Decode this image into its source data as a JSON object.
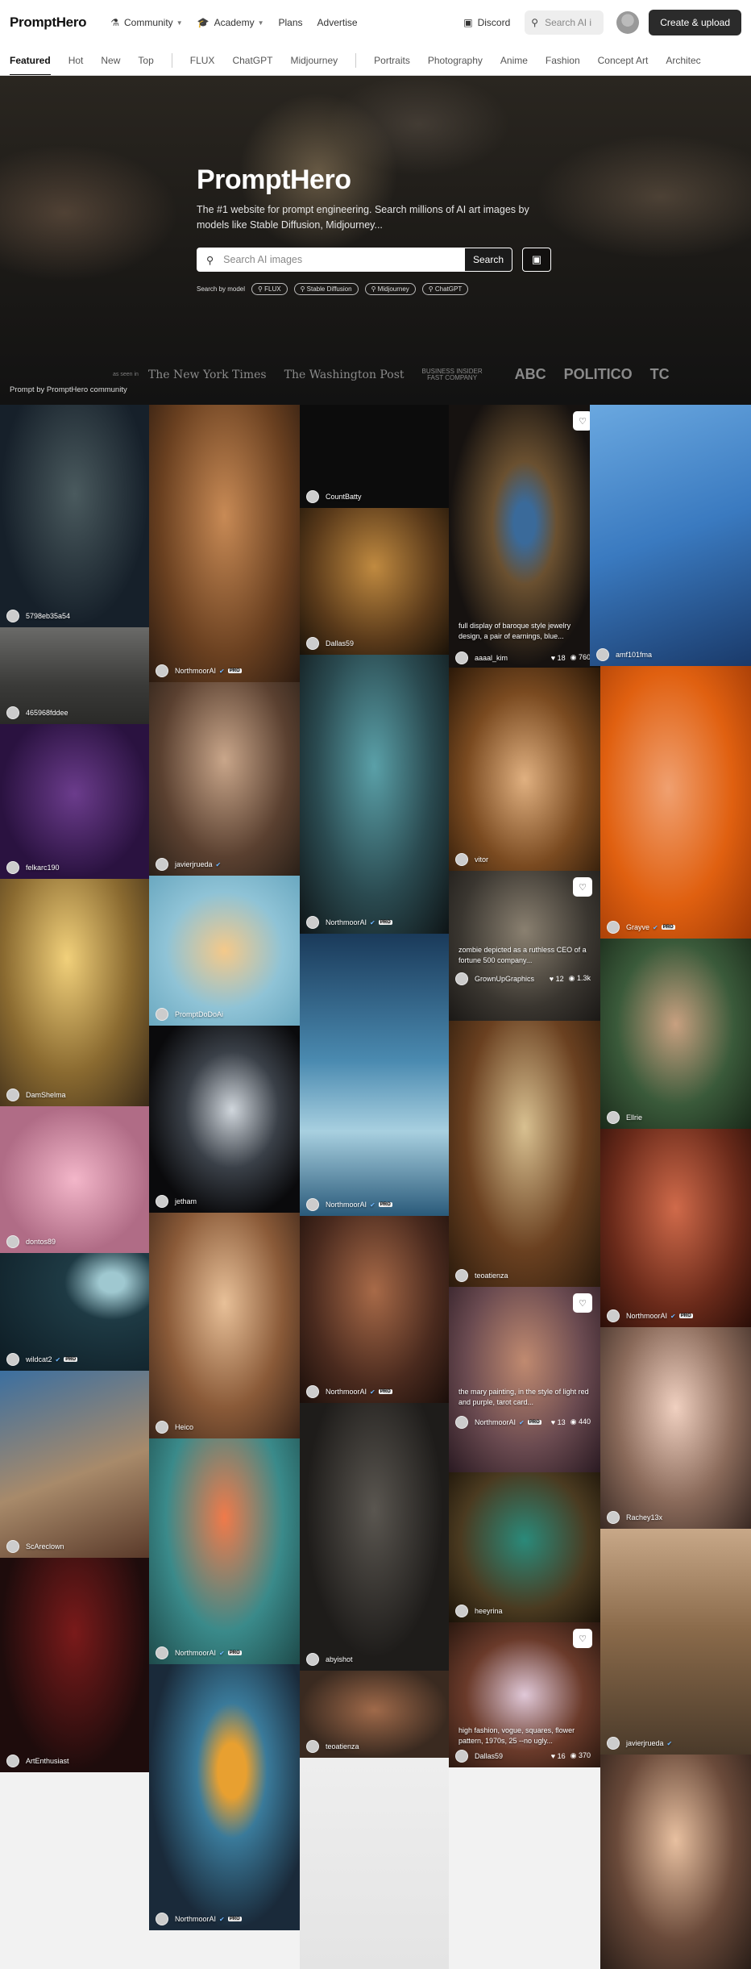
{
  "header": {
    "logo": "PromptHero",
    "nav": [
      {
        "icon": "community-icon",
        "label": "Community",
        "dropdown": true
      },
      {
        "icon": "academy-icon",
        "label": "Academy",
        "dropdown": true
      },
      {
        "icon": "",
        "label": "Plans",
        "dropdown": false
      },
      {
        "icon": "",
        "label": "Advertise",
        "dropdown": false
      }
    ],
    "discord_label": "Discord",
    "search_placeholder": "Search AI i",
    "create_button": "Create & upload"
  },
  "tabs": {
    "group1": [
      "Featured",
      "Hot",
      "New",
      "Top"
    ],
    "group2": [
      "FLUX",
      "ChatGPT",
      "Midjourney"
    ],
    "group3": [
      "Portraits",
      "Photography",
      "Anime",
      "Fashion",
      "Concept Art",
      "Architec"
    ],
    "active": "Featured"
  },
  "hero": {
    "title": "PromptHero",
    "subtitle": "The #1 website for prompt engineering. Search millions of AI art images by models like Stable Diffusion, Midjourney...",
    "search_placeholder": "Search AI images",
    "search_button": "Search",
    "models_label": "Search by model",
    "models": [
      "FLUX",
      "Stable Diffusion",
      "Midjourney",
      "ChatGPT"
    ],
    "press_label": "as seen in",
    "press": [
      "The New York Times",
      "The Washington Post",
      "BUSINESS INSIDER",
      "FAST COMPANY",
      "ABC",
      "POLITICO",
      "TC"
    ],
    "credit": "Prompt by PromptHero community"
  },
  "images": {
    "t1": {
      "user": "5798eb35a54"
    },
    "t2": {
      "user": "NorthmoorAI"
    },
    "t3": {
      "user": "CountBatty"
    },
    "t4": {
      "user": "Dallas59"
    },
    "t5": {
      "user": "aaaal_kim",
      "caption": "full display of baroque style jewelry design, a pair of earnings, blue...",
      "likes": "18",
      "views": "760"
    },
    "t6": {
      "user": "amf101fma"
    },
    "t7": {
      "user": "465968fddee"
    },
    "t8": {
      "user": "felkarc190"
    },
    "t9": {
      "user": "javierjrueda"
    },
    "t10": {
      "user": "NorthmoorAI"
    },
    "t11": {
      "user": "vitor"
    },
    "t12": {
      "user": "Grayve"
    },
    "t13": {
      "user": "DamShelma"
    },
    "t14": {
      "user": "PromptDoDoAi"
    },
    "t15": {
      "user": "GrownUpGraphics",
      "caption": "zombie depicted as a ruthless CEO of a fortune 500 company...",
      "likes": "12",
      "views": "1.3k"
    },
    "t16": {
      "user": "Ellrie"
    },
    "t17": {
      "user": "jetham"
    },
    "t18": {
      "user": "NorthmoorAI"
    },
    "t19": {
      "user": "dontos89"
    },
    "t20": {
      "user": "teoatienza"
    },
    "t21": {
      "user": "NorthmoorAI"
    },
    "t22": {
      "user": "wildcat2"
    },
    "t23": {
      "user": "Heico"
    },
    "t24": {
      "user": "NorthmoorAI"
    },
    "t25": {
      "user": "NorthmoorAI",
      "caption": "the mary painting, in the style of light red and purple, tarot card...",
      "likes": "13",
      "views": "440"
    },
    "t26": {
      "user": "Rachey13x"
    },
    "t27": {
      "user": "ScAreclown"
    },
    "t28": {
      "user": "NorthmoorAI"
    },
    "t29": {
      "user": "abyishot"
    },
    "t30": {
      "user": "heeyrina"
    },
    "t31": {
      "user": "javierjrueda"
    },
    "t32": {
      "user": "ArtEnthusiast"
    },
    "t33": {
      "user": "teoatienza"
    },
    "t34": {
      "user": "Dallas59",
      "caption": "high fashion, vogue, squares, flower pattern, 1970s, 25 --no ugly...",
      "likes": "16",
      "views": "370"
    },
    "t35": {
      "user": "NorthmoorAI"
    }
  }
}
